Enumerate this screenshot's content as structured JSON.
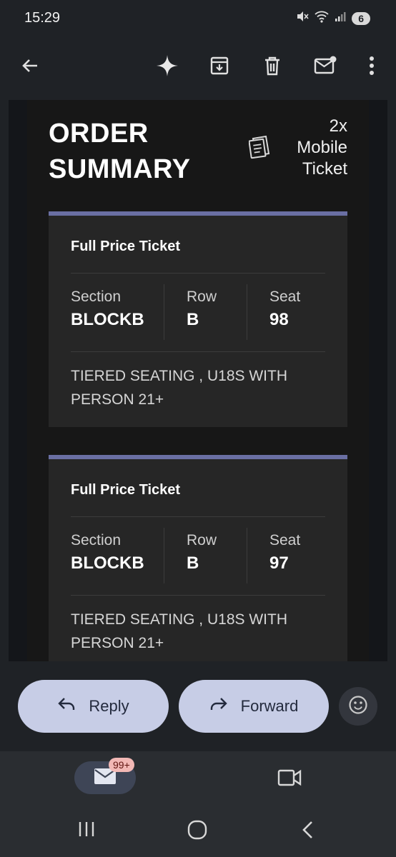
{
  "status_bar": {
    "time": "15:29",
    "battery": "6"
  },
  "toolbar": {
    "back": "arrow-left-icon",
    "icons": [
      "sparkle-icon",
      "archive-icon",
      "trash-icon",
      "mark-unread-icon",
      "more-vert-icon"
    ]
  },
  "email": {
    "title_line1": "ORDER",
    "title_line2": "SUMMARY",
    "qty_line1": "2x",
    "qty_line2": "Mobile",
    "qty_line3": "Ticket",
    "tickets": [
      {
        "type": "Full Price Ticket",
        "section_label": "Section",
        "section_value": "BLOCKB",
        "row_label": "Row",
        "row_value": "B",
        "seat_label": "Seat",
        "seat_value": "98",
        "desc_line1": "TIERED SEATING , U18S WITH",
        "desc_line2": "PERSON 21+"
      },
      {
        "type": "Full Price Ticket",
        "section_label": "Section",
        "section_value": "BLOCKB",
        "row_label": "Row",
        "row_value": "B",
        "seat_label": "Seat",
        "seat_value": "97",
        "desc_line1": "TIERED SEATING , U18S WITH",
        "desc_line2": "PERSON 21+"
      }
    ]
  },
  "actions": {
    "reply": "Reply",
    "forward": "Forward"
  },
  "bottom_nav": {
    "mail_badge": "99+"
  },
  "colors": {
    "accent": "#6a6fa3",
    "button": "#c7cde6",
    "background": "#1f2226"
  }
}
